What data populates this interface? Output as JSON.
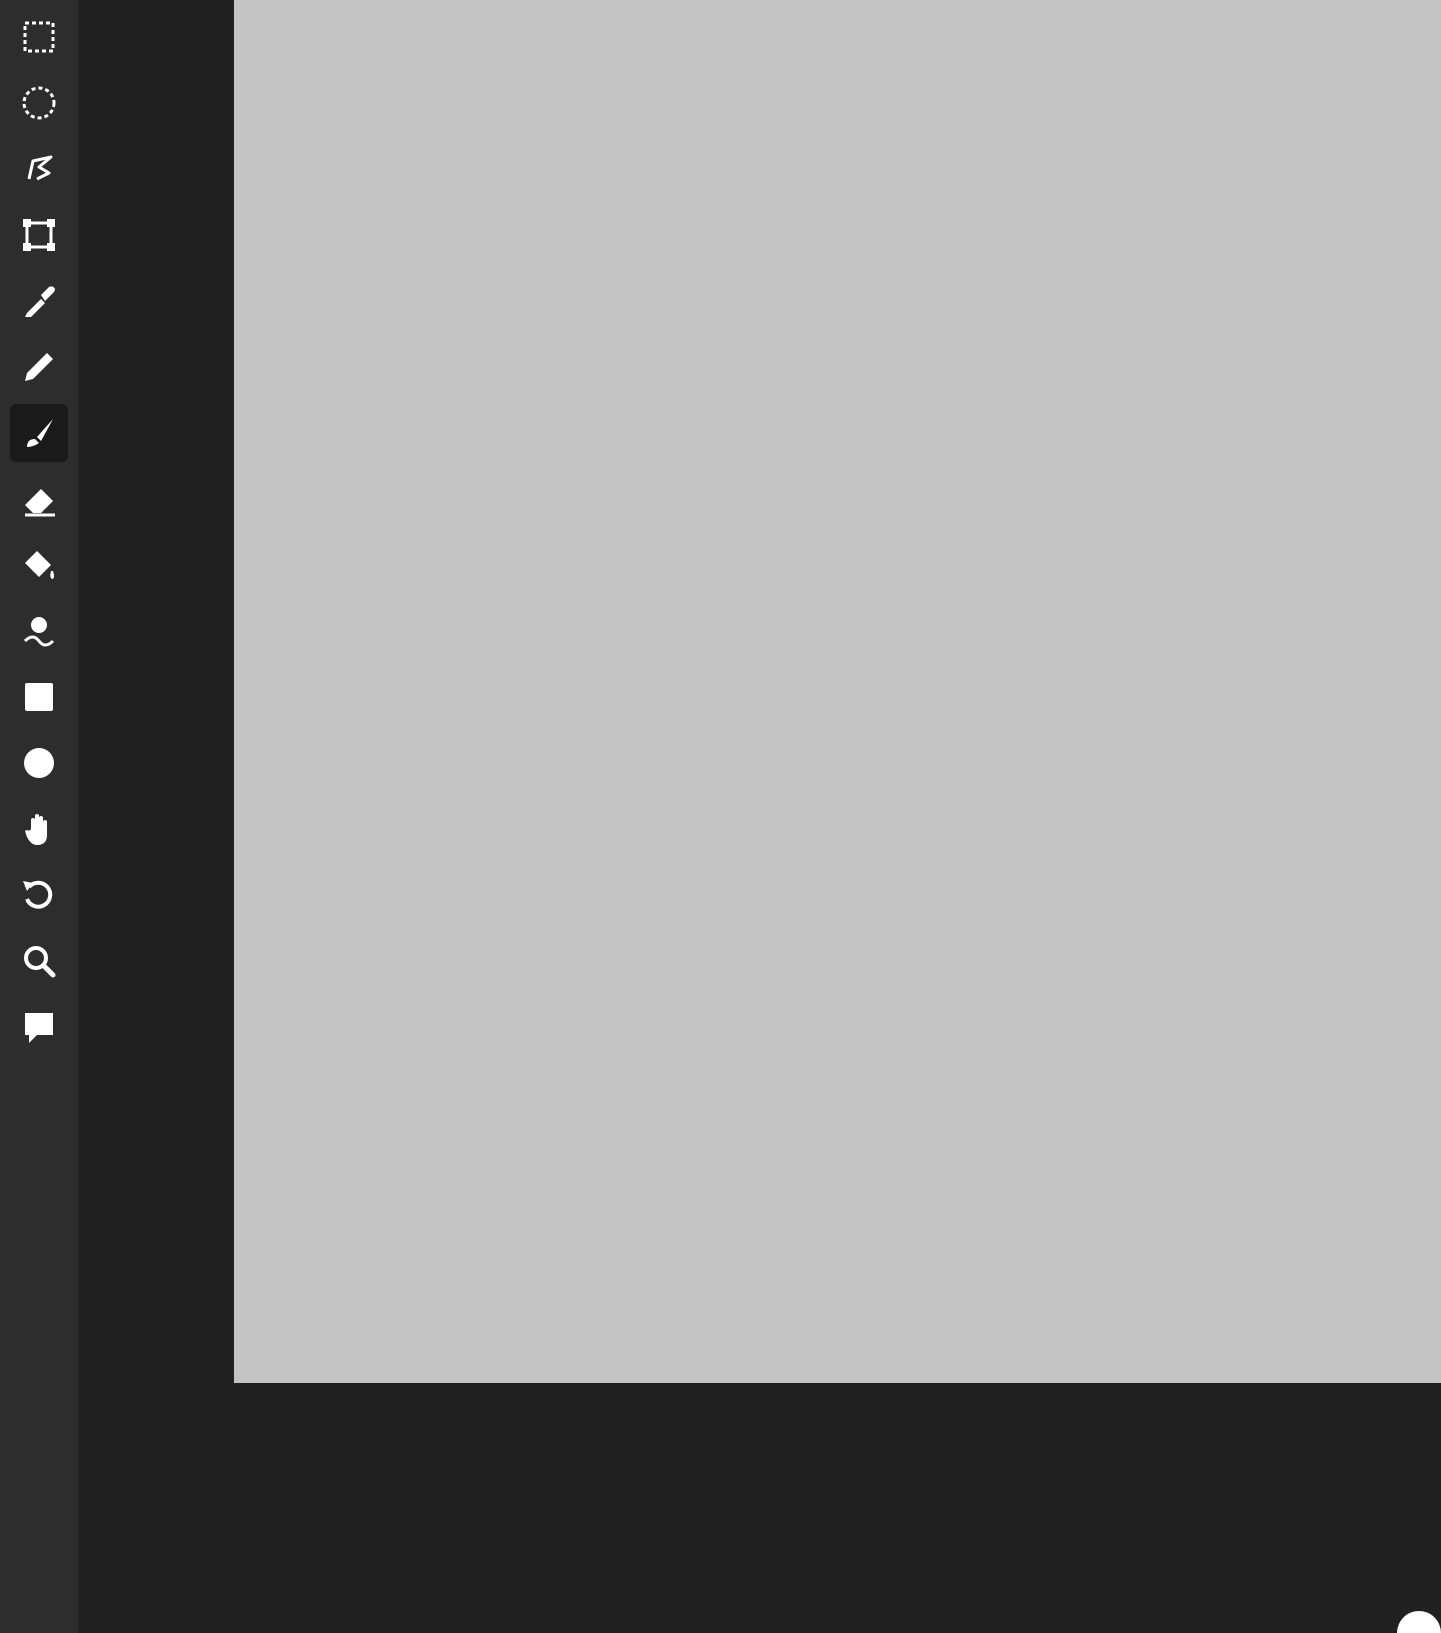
{
  "toolbar": {
    "tools": [
      {
        "name": "rectangle-select",
        "icon": "rect-select-icon"
      },
      {
        "name": "ellipse-select",
        "icon": "ellipse-select-icon"
      },
      {
        "name": "lasso-select",
        "icon": "lasso-icon"
      },
      {
        "name": "transform",
        "icon": "transform-icon"
      },
      {
        "name": "eyedropper",
        "icon": "eyedropper-icon"
      },
      {
        "name": "pencil",
        "icon": "pencil-icon"
      },
      {
        "name": "brush",
        "icon": "brush-icon",
        "active": true
      },
      {
        "name": "eraser",
        "icon": "eraser-icon"
      },
      {
        "name": "fill",
        "icon": "paint-bucket-icon"
      },
      {
        "name": "smudge",
        "icon": "smudge-icon"
      },
      {
        "name": "rectangle-shape",
        "icon": "square-icon"
      },
      {
        "name": "ellipse-shape",
        "icon": "circle-icon"
      },
      {
        "name": "pan",
        "icon": "hand-icon"
      },
      {
        "name": "undo",
        "icon": "undo-icon"
      },
      {
        "name": "zoom",
        "icon": "magnifier-icon"
      },
      {
        "name": "comment",
        "icon": "speech-bubble-icon"
      }
    ]
  },
  "colors": {
    "toolbar_bg": "#2d2d2d",
    "workspace_bg": "#212121",
    "canvas_bg": "#c4c4c4",
    "icon": "#ffffff",
    "active_tool_bg": "#1a1a1a"
  }
}
